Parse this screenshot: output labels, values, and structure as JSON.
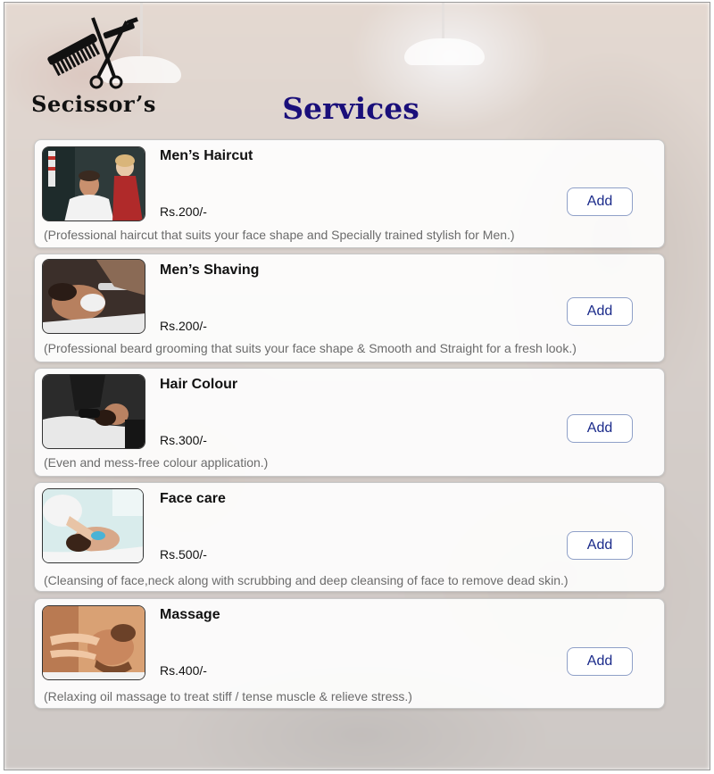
{
  "brand": {
    "name": "Secissor’s",
    "logo_icon": "comb-scissors-razor-icon"
  },
  "page": {
    "title": "Services"
  },
  "services": [
    {
      "name": "Men’s Haircut",
      "price": "Rs.200/-",
      "description": "(Professional haircut that suits your face shape and Specially trained stylish  for Men.)",
      "add_label": "Add",
      "image": "barber-haircut-photo"
    },
    {
      "name": "Men’s Shaving",
      "price": "Rs.200/-",
      "description": "(Professional beard grooming that suits your face shape & Smooth and Straight for a fresh look.)",
      "add_label": "Add",
      "image": "shaving-photo"
    },
    {
      "name": "Hair Colour",
      "price": "Rs.300/-",
      "description": "(Even and mess-free colour application.)",
      "add_label": "Add",
      "image": "hair-wash-photo"
    },
    {
      "name": "Face care",
      "price": "Rs.500/-",
      "description": "(Cleansing of face,neck along with scrubbing and deep cleansing of face to remove dead skin.)",
      "add_label": "Add",
      "image": "facial-photo"
    },
    {
      "name": "Massage",
      "price": "Rs.400/-",
      "description": "(Relaxing oil massage to treat stiff / tense muscle & relieve stress.)",
      "add_label": "Add",
      "image": "face-massage-photo"
    }
  ],
  "colors": {
    "title": "#1a0f7a",
    "button_text": "#1a2a8a",
    "description": "#6b6b6b"
  }
}
